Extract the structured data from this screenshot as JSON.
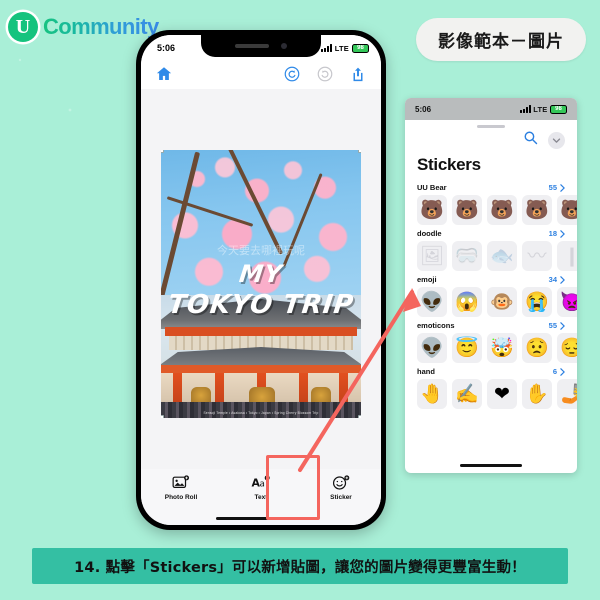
{
  "brand": {
    "mark": "U",
    "word": "Community"
  },
  "badge": {
    "label": "影像範本－圖片"
  },
  "caption": {
    "text": "14. 點擊「Stickers」可以新增貼圖，讓您的圖片變得更豐富生動！"
  },
  "phone": {
    "status": {
      "time": "5:06",
      "network": "LTE",
      "battery": "98"
    },
    "toolbar": {
      "home": "home-icon",
      "undo": "undo-icon",
      "redo": "redo-icon",
      "share": "share-icon"
    },
    "canvas": {
      "ghost_text": "今天要去哪裡玩呢",
      "line1": "MY",
      "line2": "TOKYO TRIP",
      "footer_note": "Sensoji Temple  •  Asakusa  •  Tokyo  •  Japan  •  Spring Cherry Blossom Trip"
    },
    "tools": [
      {
        "label": "Photo Roll",
        "icon": "photo-roll-icon"
      },
      {
        "label": "Text",
        "icon": "text-icon"
      },
      {
        "label": "Sticker",
        "icon": "sticker-icon"
      }
    ]
  },
  "sticker_panel": {
    "status": {
      "time": "5:06",
      "network": "LTE",
      "battery": "98"
    },
    "search_icon": "search-icon",
    "collapse_icon": "chevron-down-icon",
    "title": "Stickers",
    "categories": [
      {
        "name": "UU Bear",
        "count": "55",
        "items": [
          "🐻",
          "🐻",
          "🐻",
          "🐻",
          "🐻"
        ]
      },
      {
        "name": "doodle",
        "count": "18",
        "items": [
          "🖼",
          "🥽",
          "🐟",
          "〰",
          "❙"
        ]
      },
      {
        "name": "emoji",
        "count": "34",
        "items": [
          "👽",
          "😱",
          "🐵",
          "😭",
          "👿"
        ]
      },
      {
        "name": "emoticons",
        "count": "55",
        "items": [
          "👽",
          "😇",
          "🤯",
          "😟",
          "😔"
        ]
      },
      {
        "name": "hand",
        "count": "6",
        "items": [
          "🤚",
          "✍",
          "❤",
          "✋",
          "🤳"
        ]
      }
    ]
  },
  "annotation": {
    "arrow": "red-arrow",
    "highlight": "red-highlight-box",
    "color": "#f4655e"
  },
  "colors": {
    "background": "#a9efd7",
    "caption_bar": "#34bfa3",
    "brand_green": "#15c37e",
    "accent_blue": "#2b7fe0",
    "annotation_red": "#f4655e"
  }
}
